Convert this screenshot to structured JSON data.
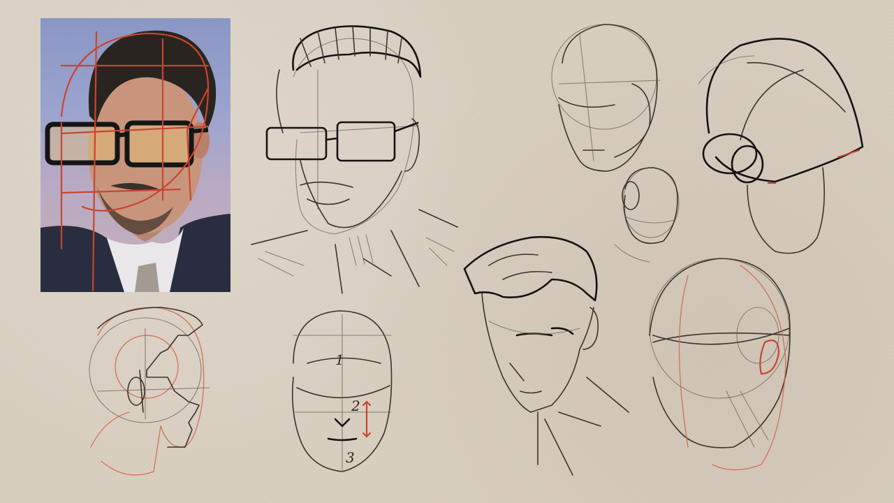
{
  "labels": {
    "proportion_1": "1",
    "proportion_2": "2",
    "proportion_3": "3"
  },
  "colors": {
    "paper": "#d9cfc1",
    "pencil": "#2b2520",
    "construction_red": "#c9452f"
  }
}
